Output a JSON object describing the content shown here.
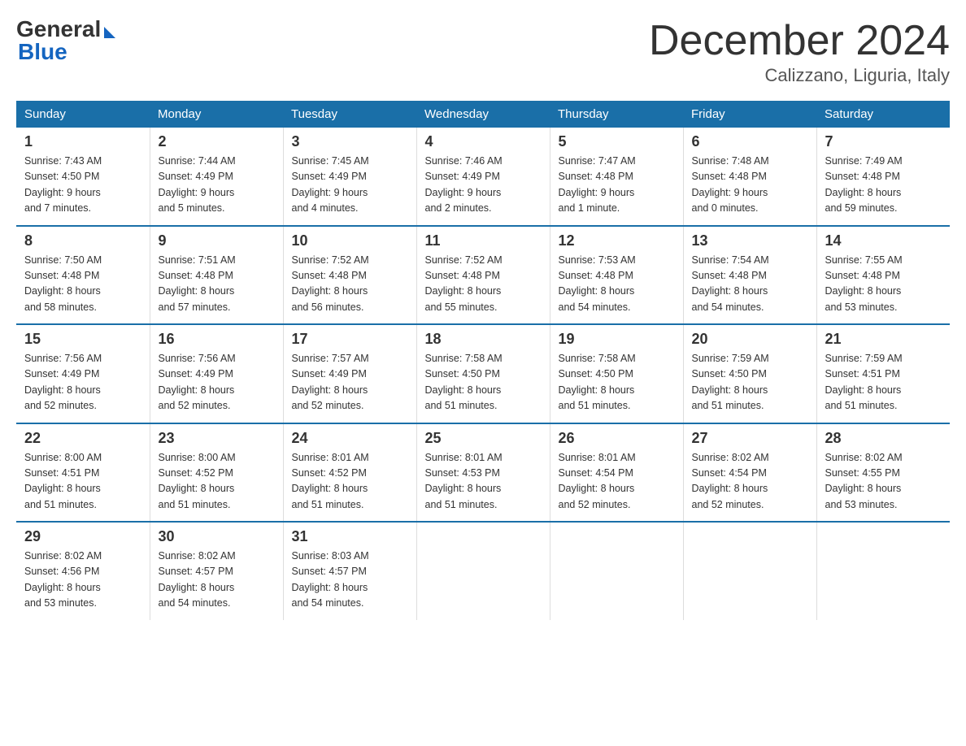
{
  "logo": {
    "general": "General",
    "blue": "Blue"
  },
  "title": "December 2024",
  "location": "Calizzano, Liguria, Italy",
  "days_of_week": [
    "Sunday",
    "Monday",
    "Tuesday",
    "Wednesday",
    "Thursday",
    "Friday",
    "Saturday"
  ],
  "weeks": [
    [
      {
        "day": "1",
        "info": "Sunrise: 7:43 AM\nSunset: 4:50 PM\nDaylight: 9 hours\nand 7 minutes."
      },
      {
        "day": "2",
        "info": "Sunrise: 7:44 AM\nSunset: 4:49 PM\nDaylight: 9 hours\nand 5 minutes."
      },
      {
        "day": "3",
        "info": "Sunrise: 7:45 AM\nSunset: 4:49 PM\nDaylight: 9 hours\nand 4 minutes."
      },
      {
        "day": "4",
        "info": "Sunrise: 7:46 AM\nSunset: 4:49 PM\nDaylight: 9 hours\nand 2 minutes."
      },
      {
        "day": "5",
        "info": "Sunrise: 7:47 AM\nSunset: 4:48 PM\nDaylight: 9 hours\nand 1 minute."
      },
      {
        "day": "6",
        "info": "Sunrise: 7:48 AM\nSunset: 4:48 PM\nDaylight: 9 hours\nand 0 minutes."
      },
      {
        "day": "7",
        "info": "Sunrise: 7:49 AM\nSunset: 4:48 PM\nDaylight: 8 hours\nand 59 minutes."
      }
    ],
    [
      {
        "day": "8",
        "info": "Sunrise: 7:50 AM\nSunset: 4:48 PM\nDaylight: 8 hours\nand 58 minutes."
      },
      {
        "day": "9",
        "info": "Sunrise: 7:51 AM\nSunset: 4:48 PM\nDaylight: 8 hours\nand 57 minutes."
      },
      {
        "day": "10",
        "info": "Sunrise: 7:52 AM\nSunset: 4:48 PM\nDaylight: 8 hours\nand 56 minutes."
      },
      {
        "day": "11",
        "info": "Sunrise: 7:52 AM\nSunset: 4:48 PM\nDaylight: 8 hours\nand 55 minutes."
      },
      {
        "day": "12",
        "info": "Sunrise: 7:53 AM\nSunset: 4:48 PM\nDaylight: 8 hours\nand 54 minutes."
      },
      {
        "day": "13",
        "info": "Sunrise: 7:54 AM\nSunset: 4:48 PM\nDaylight: 8 hours\nand 54 minutes."
      },
      {
        "day": "14",
        "info": "Sunrise: 7:55 AM\nSunset: 4:48 PM\nDaylight: 8 hours\nand 53 minutes."
      }
    ],
    [
      {
        "day": "15",
        "info": "Sunrise: 7:56 AM\nSunset: 4:49 PM\nDaylight: 8 hours\nand 52 minutes."
      },
      {
        "day": "16",
        "info": "Sunrise: 7:56 AM\nSunset: 4:49 PM\nDaylight: 8 hours\nand 52 minutes."
      },
      {
        "day": "17",
        "info": "Sunrise: 7:57 AM\nSunset: 4:49 PM\nDaylight: 8 hours\nand 52 minutes."
      },
      {
        "day": "18",
        "info": "Sunrise: 7:58 AM\nSunset: 4:50 PM\nDaylight: 8 hours\nand 51 minutes."
      },
      {
        "day": "19",
        "info": "Sunrise: 7:58 AM\nSunset: 4:50 PM\nDaylight: 8 hours\nand 51 minutes."
      },
      {
        "day": "20",
        "info": "Sunrise: 7:59 AM\nSunset: 4:50 PM\nDaylight: 8 hours\nand 51 minutes."
      },
      {
        "day": "21",
        "info": "Sunrise: 7:59 AM\nSunset: 4:51 PM\nDaylight: 8 hours\nand 51 minutes."
      }
    ],
    [
      {
        "day": "22",
        "info": "Sunrise: 8:00 AM\nSunset: 4:51 PM\nDaylight: 8 hours\nand 51 minutes."
      },
      {
        "day": "23",
        "info": "Sunrise: 8:00 AM\nSunset: 4:52 PM\nDaylight: 8 hours\nand 51 minutes."
      },
      {
        "day": "24",
        "info": "Sunrise: 8:01 AM\nSunset: 4:52 PM\nDaylight: 8 hours\nand 51 minutes."
      },
      {
        "day": "25",
        "info": "Sunrise: 8:01 AM\nSunset: 4:53 PM\nDaylight: 8 hours\nand 51 minutes."
      },
      {
        "day": "26",
        "info": "Sunrise: 8:01 AM\nSunset: 4:54 PM\nDaylight: 8 hours\nand 52 minutes."
      },
      {
        "day": "27",
        "info": "Sunrise: 8:02 AM\nSunset: 4:54 PM\nDaylight: 8 hours\nand 52 minutes."
      },
      {
        "day": "28",
        "info": "Sunrise: 8:02 AM\nSunset: 4:55 PM\nDaylight: 8 hours\nand 53 minutes."
      }
    ],
    [
      {
        "day": "29",
        "info": "Sunrise: 8:02 AM\nSunset: 4:56 PM\nDaylight: 8 hours\nand 53 minutes."
      },
      {
        "day": "30",
        "info": "Sunrise: 8:02 AM\nSunset: 4:57 PM\nDaylight: 8 hours\nand 54 minutes."
      },
      {
        "day": "31",
        "info": "Sunrise: 8:03 AM\nSunset: 4:57 PM\nDaylight: 8 hours\nand 54 minutes."
      },
      {
        "day": "",
        "info": ""
      },
      {
        "day": "",
        "info": ""
      },
      {
        "day": "",
        "info": ""
      },
      {
        "day": "",
        "info": ""
      }
    ]
  ]
}
